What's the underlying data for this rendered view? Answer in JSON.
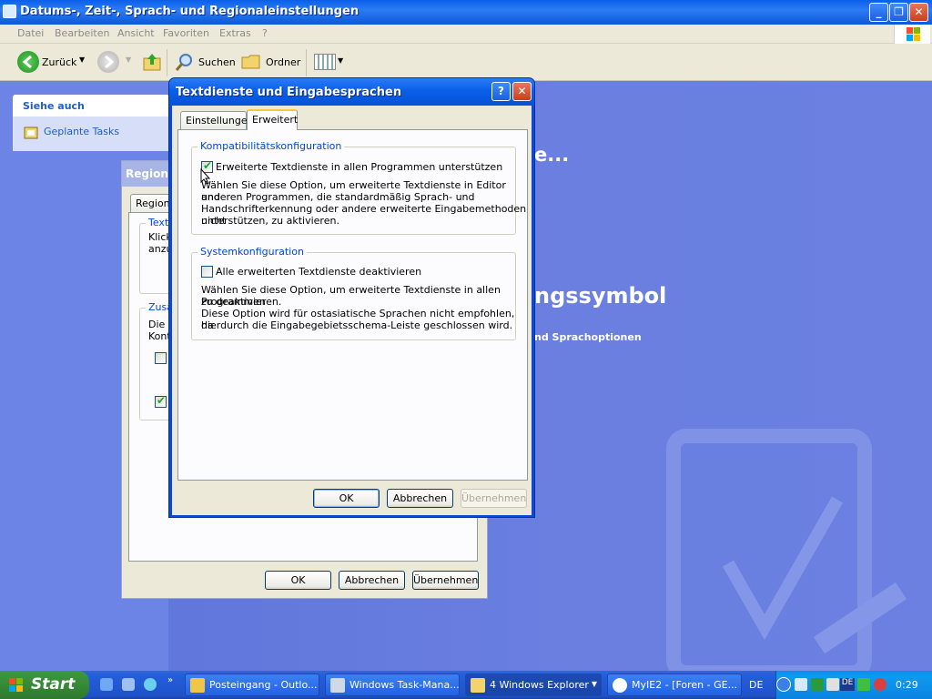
{
  "window": {
    "title": "Datums-, Zeit-, Sprach- und Regionaleinstellungen",
    "menu": [
      "Datei",
      "Bearbeiten",
      "Ansicht",
      "Favoriten",
      "Extras",
      "?"
    ],
    "toolbar": {
      "back": "Zurück",
      "search": "Suchen",
      "folders": "Ordner"
    }
  },
  "task_pane": {
    "heading": "Siehe auch",
    "link": "Geplante Tasks"
  },
  "background_text": {
    "line1": "e...",
    "line2": "ngssymbol",
    "line3": "nd Sprachoptionen"
  },
  "regional_dialog": {
    "title": "Regions",
    "tab": "Region",
    "group1_label": "Texte",
    "group1_text1": "Klick",
    "group1_text2": "anzu",
    "group2_label": "Zusä",
    "group2_text1": "Die n",
    "group2_text2": "Kont",
    "buttons": {
      "ok": "OK",
      "cancel": "Abbrechen",
      "apply": "Übernehmen"
    }
  },
  "dialog": {
    "title": "Textdienste und Eingabesprachen",
    "tabs": [
      "Einstellungen",
      "Erweitert"
    ],
    "active_tab": "Erweitert",
    "compat": {
      "label": "Kompatibilitätskonfiguration",
      "checkbox_label": "Erweiterte Textdienste in allen Programmen unterstützen",
      "checked": true,
      "desc": [
        "Wählen Sie diese Option, um erweiterte Textdienste in Editor und",
        "anderen Programmen, die standardmäßig Sprach- und",
        "Handschrifterkennung oder andere erweiterte Eingabemethoden nicht",
        "unterstützen, zu aktivieren."
      ]
    },
    "system": {
      "label": "Systemkonfiguration",
      "checkbox_label": "Alle erweiterten Textdienste deaktivieren",
      "checked": false,
      "desc": [
        "Wählen Sie diese Option, um erweiterte Textdienste in allen Programmen",
        "zu deaktivieren.",
        "Diese Option wird für ostasiatische Sprachen nicht empfohlen, da",
        "hierdurch die Eingabegebietsschema-Leiste geschlossen wird."
      ]
    },
    "buttons": {
      "ok": "OK",
      "cancel": "Abbrechen",
      "apply": "Übernehmen"
    }
  },
  "taskbar": {
    "start": "Start",
    "tasks": [
      {
        "label": "Posteingang - Outlo..."
      },
      {
        "label": "Windows Task-Mana..."
      },
      {
        "label": "4 Windows Explorer"
      },
      {
        "label": "MyIE2 - [Foren - GE..."
      }
    ],
    "lang": "DE",
    "tray_lang": "DE",
    "clock": "0:29"
  },
  "colors": {
    "accent": "#0a5fe8",
    "group_label": "#0046d5",
    "link": "#215dc6"
  }
}
